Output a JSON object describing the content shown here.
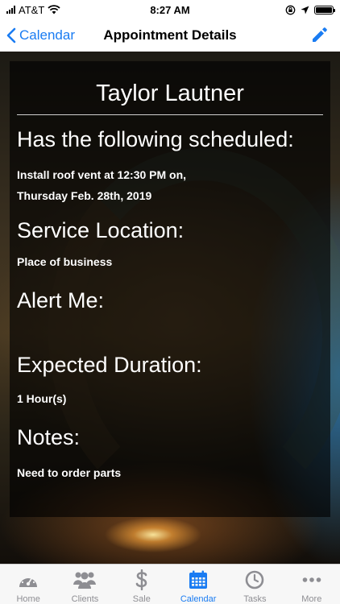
{
  "status_bar": {
    "carrier": "AT&T",
    "time": "8:27 AM"
  },
  "nav": {
    "back_label": "Calendar",
    "title": "Appointment Details",
    "edit_icon": "pencil-icon",
    "accent_color": "#1a7cf2"
  },
  "appointment": {
    "client_name": "Taylor Lautner",
    "scheduled_heading": "Has the following scheduled:",
    "scheduled_line1": "Install roof vent at 12:30 PM on,",
    "scheduled_line2": "Thursday Feb. 28th, 2019",
    "location_heading": "Service Location:",
    "location_value": "Place of business",
    "alert_heading": "Alert Me:",
    "duration_heading": "Expected Duration:",
    "duration_value": "1 Hour(s)",
    "notes_heading": "Notes:",
    "notes_value": "Need to order parts"
  },
  "tabs": [
    {
      "label": "Home",
      "icon": "dashboard-icon",
      "active": false
    },
    {
      "label": "Clients",
      "icon": "people-icon",
      "active": false
    },
    {
      "label": "Sale",
      "icon": "dollar-icon",
      "active": false
    },
    {
      "label": "Calendar",
      "icon": "calendar-icon",
      "active": true
    },
    {
      "label": "Tasks",
      "icon": "clock-icon",
      "active": false
    },
    {
      "label": "More",
      "icon": "more-icon",
      "active": false
    }
  ]
}
